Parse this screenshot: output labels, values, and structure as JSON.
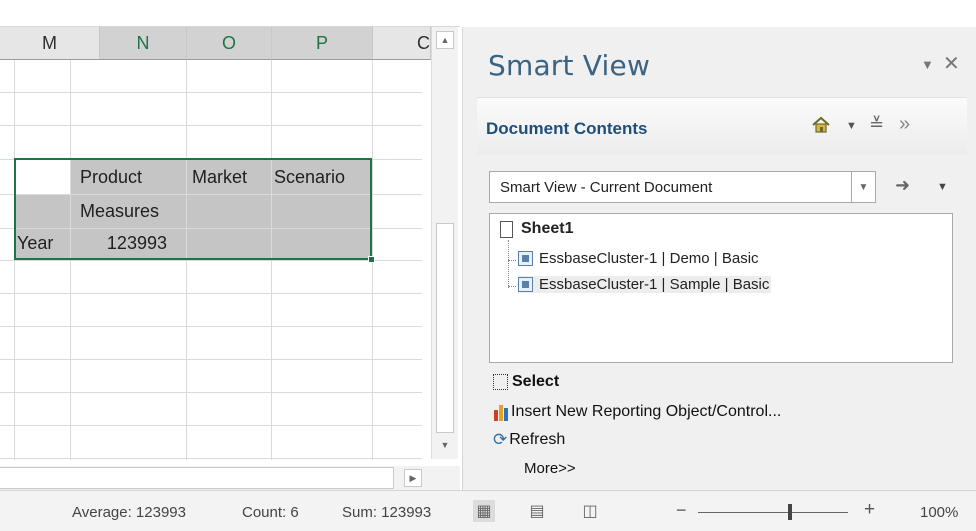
{
  "sheet": {
    "columns": [
      "M",
      "N",
      "O",
      "P",
      "C"
    ],
    "cells": {
      "product": "Product",
      "market": "Market",
      "scenario": "Scenario",
      "measures": "Measures",
      "year": "Year",
      "value": "123993"
    }
  },
  "pane": {
    "title": "Smart View",
    "section_title": "Document Contents",
    "combo_value": "Smart View - Current Document",
    "tree": {
      "root": "Sheet1",
      "items": [
        "EssbaseCluster-1 | Demo | Basic",
        "EssbaseCluster-1 | Sample | Basic"
      ]
    },
    "actions": {
      "select": "Select",
      "insert": "Insert New Reporting Object/Control...",
      "refresh": "Refresh",
      "more": "More>>"
    }
  },
  "status": {
    "average": "Average: 123993",
    "count": "Count: 6",
    "sum": "Sum: 123993",
    "zoom": "100%"
  },
  "icons": [
    "home-icon",
    "chevron-down-icon",
    "double-chevron-down-icon",
    "double-chevron-right-icon",
    "arrow-right-icon",
    "close-icon",
    "pin-icon",
    "sheet-icon",
    "connection-icon",
    "select-icon",
    "reporting-object-icon",
    "refresh-icon",
    "normal-view-icon",
    "page-layout-icon",
    "page-break-icon"
  ],
  "colors": {
    "accent": "#217346",
    "title": "#3c6382",
    "section": "#1f4e79"
  }
}
